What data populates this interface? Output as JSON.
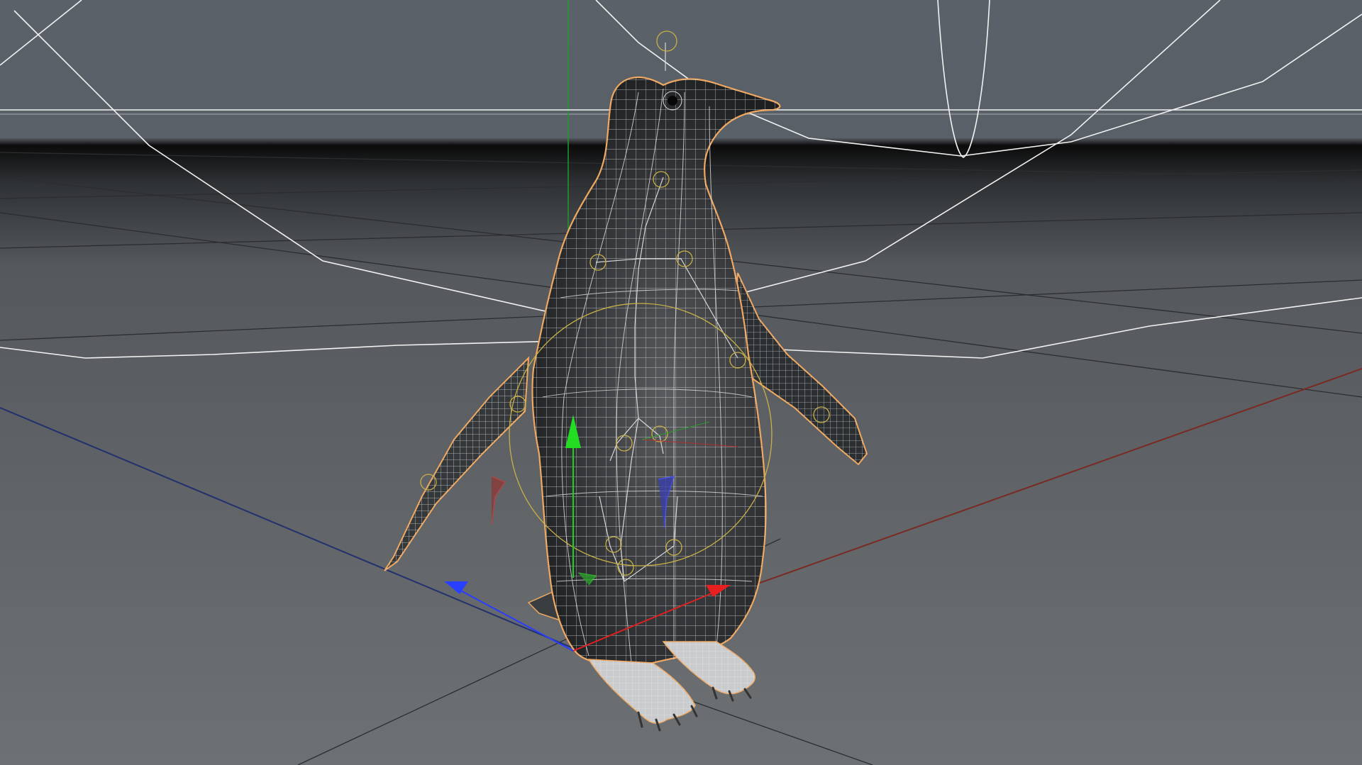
{
  "viewport": {
    "colors": {
      "background_top": "#5b6168",
      "background_bottom": "#6b6f73",
      "horizon_dark": "#0a0a0a",
      "floor_grid": "#2a2c2e",
      "spline": "#f2f2f2",
      "axis_x": "#e02020",
      "axis_y": "#20d020",
      "axis_z": "#2a3cff",
      "world_axis_x": "#7a2a22",
      "world_axis_z": "#23306e",
      "world_axis_y": "#1f9a2a",
      "mesh_body": "#2e3033",
      "mesh_wire": "#e8e8e8",
      "selection_outline": "#f0a860",
      "joint": "#c8b046"
    }
  }
}
